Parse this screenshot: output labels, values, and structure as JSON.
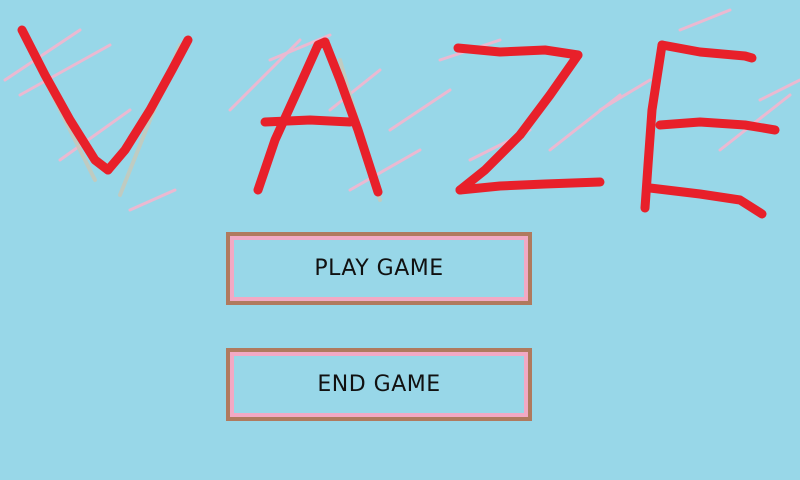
{
  "title": {
    "text": "VAZE",
    "letters": [
      "V",
      "A",
      "Z",
      "E"
    ],
    "stroke_color": "#e8202a",
    "scratch_colors": [
      "#f4b6cf",
      "#c9c9b8"
    ]
  },
  "menu": {
    "play_label": "PLAY GAME",
    "end_label": "END GAME"
  },
  "colors": {
    "background": "#98d7e8",
    "button_border_outer": "#b07a5e",
    "button_border_inner": "#f2a9c4",
    "text": "#111111"
  }
}
